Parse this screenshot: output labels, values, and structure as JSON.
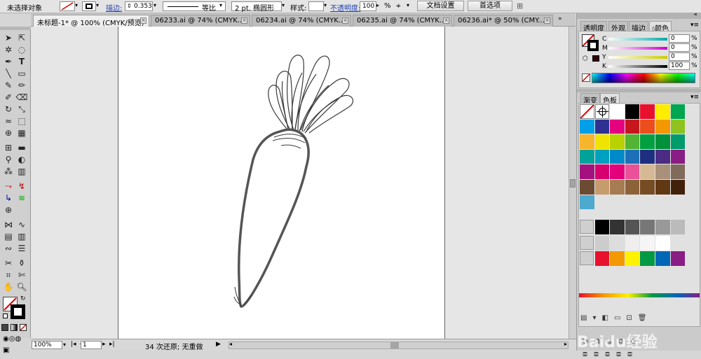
{
  "control_bar": {
    "selection_status": "未选择对象",
    "stroke_label": "描边:",
    "stroke_weight": "0.353",
    "profile_label": "等比",
    "brush_label": "2 pt. 椭圆形",
    "style_label": "样式:",
    "opacity_label": "不透明度:",
    "opacity_value": "100",
    "opacity_unit": "%",
    "doc_setup_button": "文档设置",
    "preferences_button": "首选项"
  },
  "tabs": [
    {
      "label": "未标题-1* @ 100% (CMYK/预览)",
      "active": true
    },
    {
      "label": "06233.ai @ 74% (CMYK..."
    },
    {
      "label": "06234.ai @ 74% (CMYK..."
    },
    {
      "label": "06235.ai @ 74% (CMYK..."
    },
    {
      "label": "06236.ai* @ 50% (CMY..."
    }
  ],
  "color_panel": {
    "tabs": [
      "透明度",
      "外观",
      "描边",
      "颜色"
    ],
    "channels": [
      {
        "label": "C",
        "value": "0"
      },
      {
        "label": "M",
        "value": "0"
      },
      {
        "label": "Y",
        "value": "0"
      },
      {
        "label": "K",
        "value": "100"
      }
    ]
  },
  "swatch_panel": {
    "tabs": [
      "渐变",
      "色板"
    ]
  },
  "status_bar": {
    "zoom": "100%",
    "page": "1",
    "message": "34 次还原; 无重做"
  },
  "watermark": "Baidu经验"
}
